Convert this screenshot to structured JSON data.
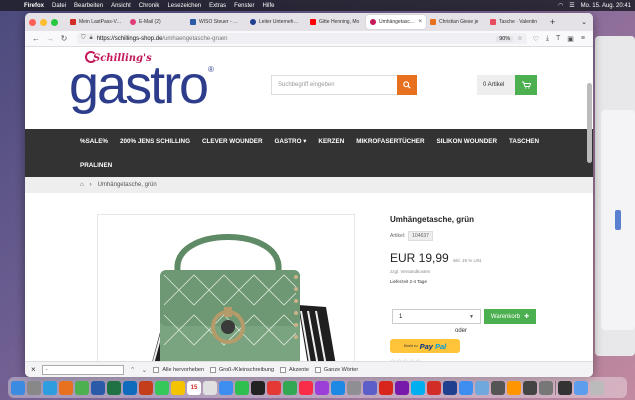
{
  "menubar": {
    "items": [
      "Firefox",
      "Datei",
      "Bearbeiten",
      "Ansicht",
      "Chronik",
      "Lesezeichen",
      "Extras",
      "Fenster",
      "Hilfe"
    ],
    "clock": "Mo. 15. Aug. 20:41"
  },
  "tabs": [
    {
      "label": "Mein LastPass-Vault",
      "color": "#d32d27"
    },
    {
      "label": "E-Mail (2)",
      "color": "#e03c78"
    },
    {
      "label": "WISO Steuer - Mein",
      "color": "#2b5aa8"
    },
    {
      "label": "Leiter Unternehmen",
      "color": "#1f3f8f"
    },
    {
      "label": "Gitte Henning, Mo",
      "color": "#ff0000"
    },
    {
      "label": "Umhängetasche, grün",
      "color": "#c3185a",
      "active": true
    },
    {
      "label": "Christian Giese je",
      "color": "#e8711f"
    },
    {
      "label": "Tasche · Valentin",
      "color": "#e84a5f"
    }
  ],
  "nav": {
    "url_host": "https://schillings-shop.de",
    "url_path": "/umhaengetasche-gruen",
    "zoom": "90%"
  },
  "logo": {
    "script": "Schilling's",
    "word": "gastro",
    "reg": "®"
  },
  "search": {
    "placeholder": "Suchbegriff eingeben"
  },
  "cart": {
    "label": "0 Artikel"
  },
  "menu": {
    "row1": [
      "%SALE%",
      "200% JENS SCHILLING",
      "CLEVER WOUNDER",
      "GASTRO ▾",
      "KERZEN",
      "MIKROFASERTÜCHER",
      "SILIKON WOUNDER",
      "TASCHEN"
    ],
    "row2": [
      "PRALINEN"
    ]
  },
  "breadcrumb": {
    "current": "Umhängetasche, grün"
  },
  "product": {
    "title": "Umhängetasche, grün",
    "partno_label": "Artikel:",
    "partno": "104637",
    "price": "EUR 19,99",
    "vat": "inkl. 19 % USt.",
    "shipping": "zzgl. Versandkosten",
    "delivery": "Lieferzeit 2-4 Tage",
    "qty": "1",
    "add_to_cart": "Warenkorb",
    "or": "oder",
    "paypal_small": "Direkt zu",
    "paypal_1": "Pay",
    "paypal_2": "Pal",
    "stars": "☆☆☆☆☆"
  },
  "findbar": {
    "input": "-",
    "opt1": "Alle hervorheben",
    "opt2": "Groß-/Kleinschreibung",
    "opt3": "Akzente",
    "opt4": "Ganze Wörter"
  },
  "dock": {
    "calendar_day": "15",
    "icons": [
      {
        "name": "finder-icon",
        "color": "#3b8be0"
      },
      {
        "name": "launchpad-icon",
        "color": "#888888"
      },
      {
        "name": "safari-icon",
        "color": "#2e9de0"
      },
      {
        "name": "firefox-icon",
        "color": "#e8711f"
      },
      {
        "name": "chrome-icon",
        "color": "#4caf50"
      },
      {
        "name": "word-icon",
        "color": "#2b5aa8"
      },
      {
        "name": "excel-icon",
        "color": "#207245"
      },
      {
        "name": "outlook-icon",
        "color": "#0f6cbd"
      },
      {
        "name": "powerpoint-icon",
        "color": "#c43e1c"
      },
      {
        "name": "messages-icon",
        "color": "#34c759"
      },
      {
        "name": "notes-icon",
        "color": "#f5c400"
      },
      {
        "name": "calendar-icon",
        "color": "#ffffff"
      },
      {
        "name": "photos-icon",
        "color": "#e0e0e0"
      },
      {
        "name": "mail-icon",
        "color": "#3d8ef0"
      },
      {
        "name": "facetime-icon",
        "color": "#2fbf4e"
      },
      {
        "name": "appletv-icon",
        "color": "#222222"
      },
      {
        "name": "news-icon",
        "color": "#e53935"
      },
      {
        "name": "numbers-icon",
        "color": "#33a852"
      },
      {
        "name": "music-icon",
        "color": "#fa2d48"
      },
      {
        "name": "podcasts-icon",
        "color": "#9c3fd9"
      },
      {
        "name": "appstore-icon",
        "color": "#1e88e5"
      },
      {
        "name": "settings-icon",
        "color": "#8e8e93"
      },
      {
        "name": "teams-icon",
        "color": "#5b5fc7"
      },
      {
        "name": "acrobat-icon",
        "color": "#d9261c"
      },
      {
        "name": "onenote-icon",
        "color": "#7719aa"
      },
      {
        "name": "skype-icon",
        "color": "#00aff0"
      },
      {
        "name": "lastpass-icon",
        "color": "#d32d27"
      },
      {
        "name": "steuer-icon",
        "color": "#1f3f8f"
      },
      {
        "name": "spark-icon",
        "color": "#3d8ef0"
      },
      {
        "name": "preview-icon",
        "color": "#6fa8dc"
      },
      {
        "name": "calculator-icon",
        "color": "#555555"
      },
      {
        "name": "firefox2-icon",
        "color": "#ff9500"
      },
      {
        "name": "video-icon",
        "color": "#444444"
      },
      {
        "name": "screenshot-icon",
        "color": "#777777"
      },
      {
        "name": "activity-icon",
        "color": "#333333"
      },
      {
        "name": "downloads-icon",
        "color": "#5c9ded"
      },
      {
        "name": "trash-icon",
        "color": "#bbbbbb"
      }
    ]
  }
}
